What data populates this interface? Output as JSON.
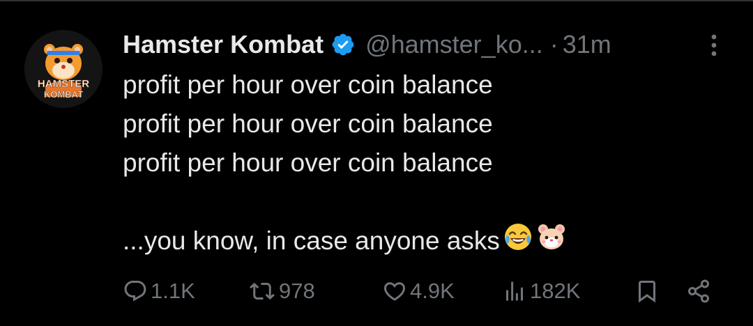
{
  "tweet": {
    "author": {
      "display_name": "Hamster Kombat",
      "handle": "@hamster_ko...",
      "verified": true,
      "avatar_text_line1": "HAMSTER",
      "avatar_text_line2": "KOMBAT"
    },
    "separator": "·",
    "time": "31m",
    "text_lines": [
      "profit per hour over coin balance",
      "profit per hour over coin balance",
      "profit per hour over coin balance"
    ],
    "closing_line": "...you know, in case anyone asks",
    "emojis": [
      "face-with-tears-of-joy",
      "hamster-face"
    ],
    "stats": {
      "replies": "1.1K",
      "reposts": "978",
      "likes": "4.9K",
      "views": "182K"
    }
  },
  "icons": {
    "verified": "verified-badge-icon",
    "more": "more-options-icon",
    "reply": "reply-icon",
    "repost": "repost-icon",
    "like": "heart-icon",
    "views": "views-chart-icon",
    "bookmark": "bookmark-icon",
    "share": "share-icon"
  },
  "colors": {
    "background": "#000000",
    "text_primary": "#e7e9ea",
    "text_secondary": "#71767b",
    "verified_blue": "#1d9bf0",
    "avatar_accent": "#f39b2f"
  }
}
